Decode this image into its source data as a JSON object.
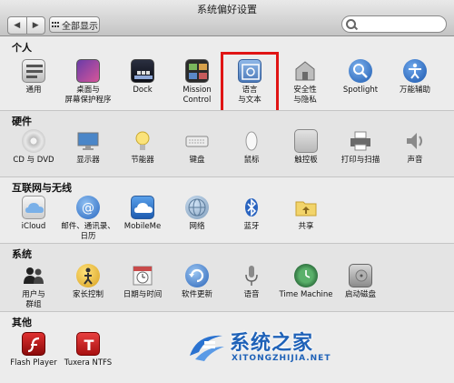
{
  "window": {
    "title": "系统偏好设置"
  },
  "toolbar": {
    "back_label": "◀",
    "forward_label": "▶",
    "show_all_label": "全部显示",
    "search_placeholder": ""
  },
  "sections": {
    "personal": {
      "title": "个人",
      "items": [
        {
          "label": "通用",
          "icon": "general-icon"
        },
        {
          "label": "桌面与\n屏幕保护程序",
          "icon": "desktop-icon"
        },
        {
          "label": "Dock",
          "icon": "dock-icon"
        },
        {
          "label": "Mission\nControl",
          "icon": "mission-control-icon"
        },
        {
          "label": "语言\n与文本",
          "icon": "language-text-icon"
        },
        {
          "label": "安全性\n与隐私",
          "icon": "security-icon"
        },
        {
          "label": "Spotlight",
          "icon": "spotlight-icon"
        },
        {
          "label": "万能辅助",
          "icon": "accessibility-icon"
        }
      ]
    },
    "hardware": {
      "title": "硬件",
      "items": [
        {
          "label": "CD 与 DVD",
          "icon": "cd-dvd-icon"
        },
        {
          "label": "显示器",
          "icon": "display-icon"
        },
        {
          "label": "节能器",
          "icon": "energy-saver-icon"
        },
        {
          "label": "键盘",
          "icon": "keyboard-icon"
        },
        {
          "label": "鼠标",
          "icon": "mouse-icon"
        },
        {
          "label": "触控板",
          "icon": "trackpad-icon"
        },
        {
          "label": "打印与扫描",
          "icon": "print-scan-icon"
        },
        {
          "label": "声音",
          "icon": "sound-icon"
        }
      ]
    },
    "internet": {
      "title": "互联网与无线",
      "items": [
        {
          "label": "iCloud",
          "icon": "icloud-icon"
        },
        {
          "label": "邮件、通讯录、\n日历",
          "icon": "mail-contacts-icon"
        },
        {
          "label": "MobileMe",
          "icon": "mobileme-icon"
        },
        {
          "label": "网络",
          "icon": "network-icon"
        },
        {
          "label": "蓝牙",
          "icon": "bluetooth-icon"
        },
        {
          "label": "共享",
          "icon": "sharing-icon"
        }
      ]
    },
    "system": {
      "title": "系统",
      "items": [
        {
          "label": "用户与\n群组",
          "icon": "users-groups-icon"
        },
        {
          "label": "家长控制",
          "icon": "parental-controls-icon"
        },
        {
          "label": "日期与时间",
          "icon": "date-time-icon"
        },
        {
          "label": "软件更新",
          "icon": "software-update-icon"
        },
        {
          "label": "语音",
          "icon": "speech-icon"
        },
        {
          "label": "Time Machine",
          "icon": "time-machine-icon"
        },
        {
          "label": "启动磁盘",
          "icon": "startup-disk-icon"
        }
      ]
    },
    "other": {
      "title": "其他",
      "items": [
        {
          "label": "Flash Player",
          "icon": "flash-player-icon"
        },
        {
          "label": "Tuxera NTFS",
          "icon": "tuxera-ntfs-icon"
        }
      ]
    }
  },
  "watermark": {
    "text": "系统之家",
    "sub": "XITONGZHIJIA.NET"
  },
  "colors": {
    "highlight": "#e01414",
    "watermark": "#1f62b8"
  }
}
